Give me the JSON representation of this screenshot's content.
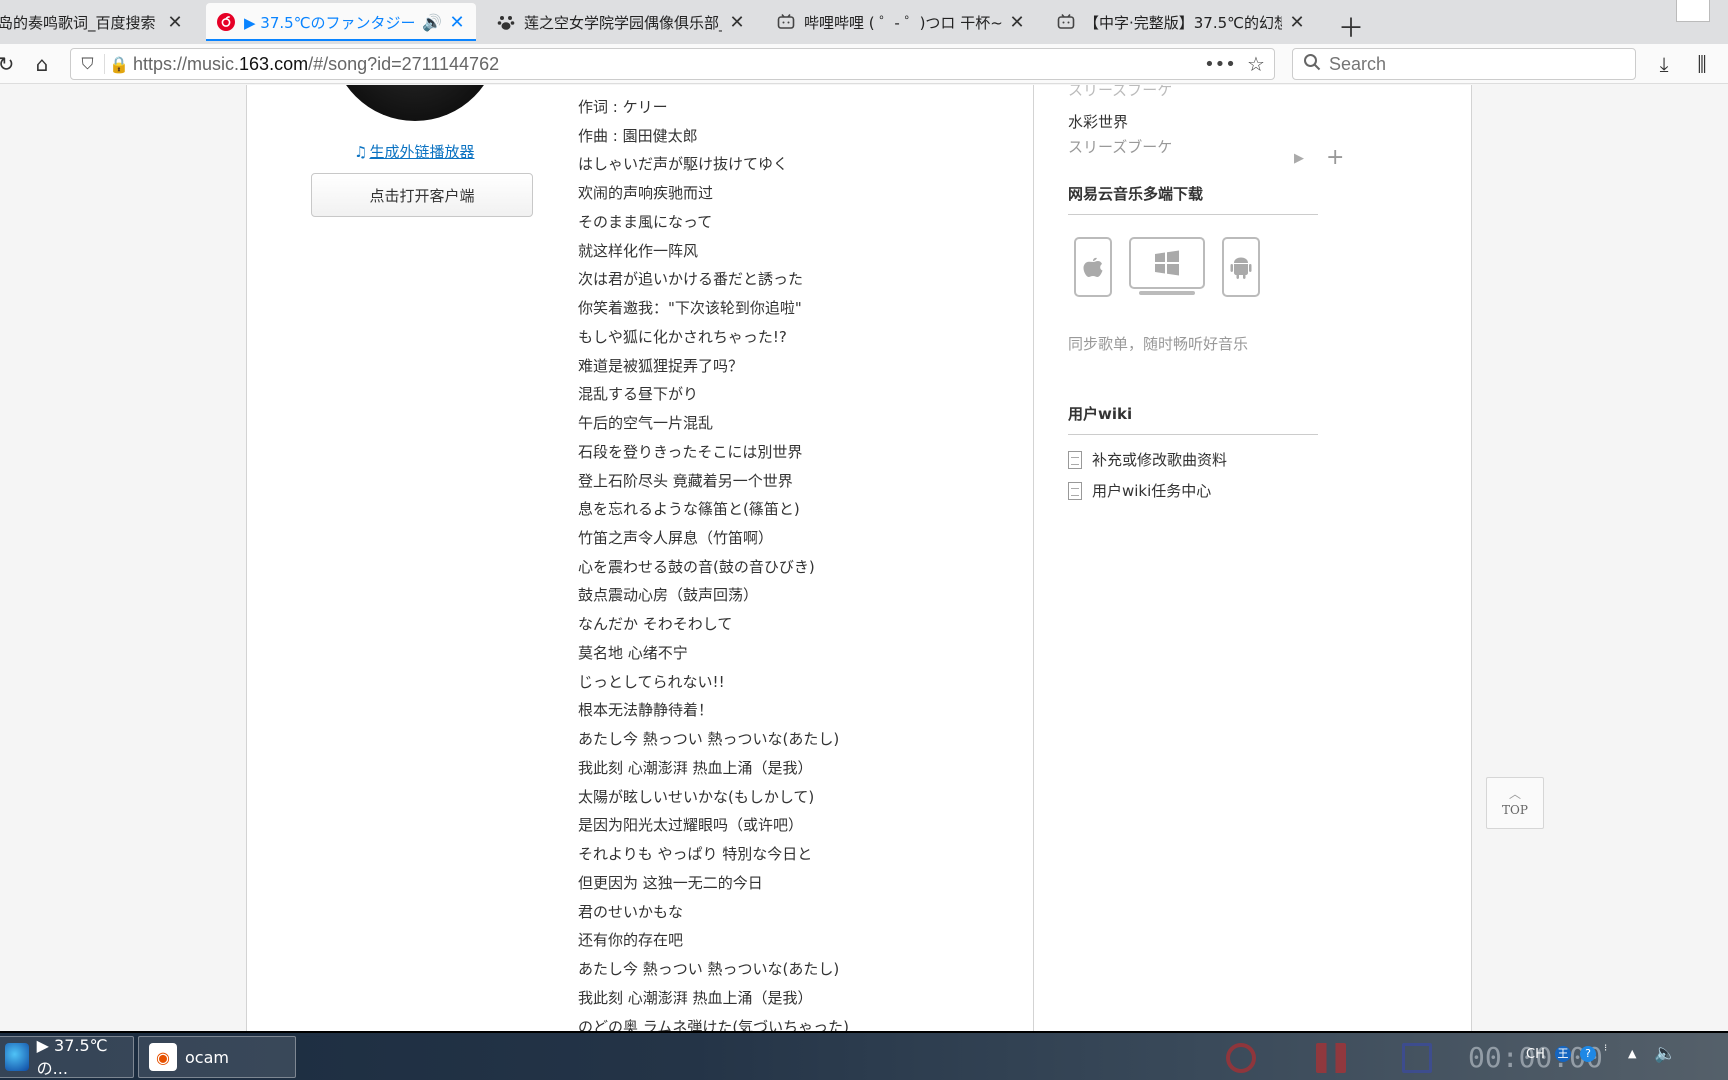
{
  "browser": {
    "tabs": [
      {
        "title": "岛的奏鸣歌词_百度搜索",
        "icon": "baidu-paw-icon"
      },
      {
        "title": "▶ 37.5℃のファンタジー",
        "icon": "netease-music-icon",
        "active": true
      },
      {
        "title": "莲之空女学院学园偶像俱乐部_",
        "icon": "baidu-paw-icon"
      },
      {
        "title": "哔哩哔哩 ( ゜- ゜)つロ 干杯~-bi",
        "icon": "bilibili-tv-icon"
      },
      {
        "title": "【中字·完整版】37.5℃的幻想(",
        "icon": "bilibili-tv-icon"
      }
    ],
    "url_prefix": "https://music.",
    "url_domain": "163.com",
    "url_suffix": "/#/song?id=2711144762",
    "search_placeholder": "Search"
  },
  "left": {
    "ext_link": "生成外链播放器",
    "client_button": "点击打开客户端"
  },
  "lyrics": [
    "作词 : ケリー",
    "作曲 : 園田健太郎",
    "はしゃいだ声が駆け抜けてゆく",
    "欢闹的声响疾驰而过",
    "そのまま風になって",
    "就这样化作一阵风",
    "次は君が追いかける番だと誘った",
    "你笑着邀我：\"下次该轮到你追啦\"",
    "もしや狐に化かされちゃった!?",
    "难道是被狐狸捉弄了吗？",
    "混乱する昼下がり",
    "午后的空气一片混乱",
    "石段を登りきったそこには別世界",
    "登上石阶尽头 竟藏着另一个世界",
    "息を忘れるような篠笛と(篠笛と)",
    "竹笛之声令人屏息（竹笛啊）",
    "心を震わせる鼓の音(鼓の音ひびき)",
    "鼓点震动心房（鼓声回荡）",
    "なんだか そわそわして",
    "莫名地 心绪不宁",
    "じっとしてられない!!",
    "根本无法静静待着！",
    "あたし今 熱っつい 熱っついな(あたし)",
    "我此刻 心潮澎湃 热血上涌（是我）",
    "太陽が眩しいせいかな(もしかして)",
    "是因为阳光太过耀眼吗（或许吧）",
    "それよりも やっぱり 特別な今日と",
    "但更因为 这独一无二的今日",
    "君のせいかもな",
    "还有你的存在吧",
    "あたし今 熱っつい 熱っついな(あたし)",
    "我此刻 心潮澎湃 热血上涌（是我）",
    "のどの奥 ラムネ弾けた(気づいちゃった)"
  ],
  "sidebar": {
    "ghost_artist": "スリーズブーケ",
    "related_song": {
      "name": "水彩世界",
      "artist": "スリーズブーケ"
    },
    "download_title": "网易云音乐多端下载",
    "download_caption": "同步歌单，随时畅听好音乐",
    "wiki_title": "用户wiki",
    "wiki_items": [
      "补充或修改歌曲资料",
      "用户wiki任务中心"
    ]
  },
  "back_to_top": "TOP",
  "taskbar": {
    "items": [
      {
        "label": "▶ 37.5℃の...",
        "icon": "netease-music-icon"
      },
      {
        "label": "ocam",
        "icon": "ocam-icon"
      }
    ],
    "tray": {
      "lang": "CH",
      "clock": "00:00:00"
    }
  }
}
